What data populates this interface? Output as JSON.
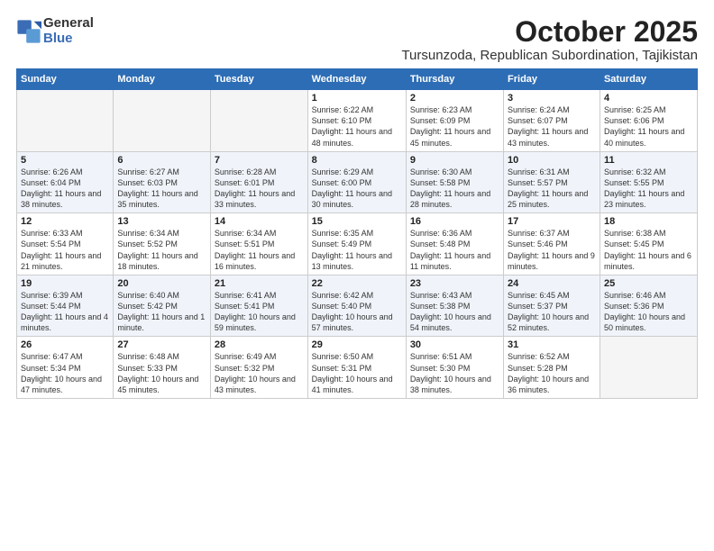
{
  "logo": {
    "general": "General",
    "blue": "Blue"
  },
  "header": {
    "month": "October 2025",
    "location": "Tursunzoda, Republican Subordination, Tajikistan"
  },
  "weekdays": [
    "Sunday",
    "Monday",
    "Tuesday",
    "Wednesday",
    "Thursday",
    "Friday",
    "Saturday"
  ],
  "weeks": [
    [
      {
        "day": null
      },
      {
        "day": null
      },
      {
        "day": null
      },
      {
        "day": "1",
        "sunrise": "6:22 AM",
        "sunset": "6:10 PM",
        "daylight": "11 hours and 48 minutes."
      },
      {
        "day": "2",
        "sunrise": "6:23 AM",
        "sunset": "6:09 PM",
        "daylight": "11 hours and 45 minutes."
      },
      {
        "day": "3",
        "sunrise": "6:24 AM",
        "sunset": "6:07 PM",
        "daylight": "11 hours and 43 minutes."
      },
      {
        "day": "4",
        "sunrise": "6:25 AM",
        "sunset": "6:06 PM",
        "daylight": "11 hours and 40 minutes."
      }
    ],
    [
      {
        "day": "5",
        "sunrise": "6:26 AM",
        "sunset": "6:04 PM",
        "daylight": "11 hours and 38 minutes."
      },
      {
        "day": "6",
        "sunrise": "6:27 AM",
        "sunset": "6:03 PM",
        "daylight": "11 hours and 35 minutes."
      },
      {
        "day": "7",
        "sunrise": "6:28 AM",
        "sunset": "6:01 PM",
        "daylight": "11 hours and 33 minutes."
      },
      {
        "day": "8",
        "sunrise": "6:29 AM",
        "sunset": "6:00 PM",
        "daylight": "11 hours and 30 minutes."
      },
      {
        "day": "9",
        "sunrise": "6:30 AM",
        "sunset": "5:58 PM",
        "daylight": "11 hours and 28 minutes."
      },
      {
        "day": "10",
        "sunrise": "6:31 AM",
        "sunset": "5:57 PM",
        "daylight": "11 hours and 25 minutes."
      },
      {
        "day": "11",
        "sunrise": "6:32 AM",
        "sunset": "5:55 PM",
        "daylight": "11 hours and 23 minutes."
      }
    ],
    [
      {
        "day": "12",
        "sunrise": "6:33 AM",
        "sunset": "5:54 PM",
        "daylight": "11 hours and 21 minutes."
      },
      {
        "day": "13",
        "sunrise": "6:34 AM",
        "sunset": "5:52 PM",
        "daylight": "11 hours and 18 minutes."
      },
      {
        "day": "14",
        "sunrise": "6:34 AM",
        "sunset": "5:51 PM",
        "daylight": "11 hours and 16 minutes."
      },
      {
        "day": "15",
        "sunrise": "6:35 AM",
        "sunset": "5:49 PM",
        "daylight": "11 hours and 13 minutes."
      },
      {
        "day": "16",
        "sunrise": "6:36 AM",
        "sunset": "5:48 PM",
        "daylight": "11 hours and 11 minutes."
      },
      {
        "day": "17",
        "sunrise": "6:37 AM",
        "sunset": "5:46 PM",
        "daylight": "11 hours and 9 minutes."
      },
      {
        "day": "18",
        "sunrise": "6:38 AM",
        "sunset": "5:45 PM",
        "daylight": "11 hours and 6 minutes."
      }
    ],
    [
      {
        "day": "19",
        "sunrise": "6:39 AM",
        "sunset": "5:44 PM",
        "daylight": "11 hours and 4 minutes."
      },
      {
        "day": "20",
        "sunrise": "6:40 AM",
        "sunset": "5:42 PM",
        "daylight": "11 hours and 1 minute."
      },
      {
        "day": "21",
        "sunrise": "6:41 AM",
        "sunset": "5:41 PM",
        "daylight": "10 hours and 59 minutes."
      },
      {
        "day": "22",
        "sunrise": "6:42 AM",
        "sunset": "5:40 PM",
        "daylight": "10 hours and 57 minutes."
      },
      {
        "day": "23",
        "sunrise": "6:43 AM",
        "sunset": "5:38 PM",
        "daylight": "10 hours and 54 minutes."
      },
      {
        "day": "24",
        "sunrise": "6:45 AM",
        "sunset": "5:37 PM",
        "daylight": "10 hours and 52 minutes."
      },
      {
        "day": "25",
        "sunrise": "6:46 AM",
        "sunset": "5:36 PM",
        "daylight": "10 hours and 50 minutes."
      }
    ],
    [
      {
        "day": "26",
        "sunrise": "6:47 AM",
        "sunset": "5:34 PM",
        "daylight": "10 hours and 47 minutes."
      },
      {
        "day": "27",
        "sunrise": "6:48 AM",
        "sunset": "5:33 PM",
        "daylight": "10 hours and 45 minutes."
      },
      {
        "day": "28",
        "sunrise": "6:49 AM",
        "sunset": "5:32 PM",
        "daylight": "10 hours and 43 minutes."
      },
      {
        "day": "29",
        "sunrise": "6:50 AM",
        "sunset": "5:31 PM",
        "daylight": "10 hours and 41 minutes."
      },
      {
        "day": "30",
        "sunrise": "6:51 AM",
        "sunset": "5:30 PM",
        "daylight": "10 hours and 38 minutes."
      },
      {
        "day": "31",
        "sunrise": "6:52 AM",
        "sunset": "5:28 PM",
        "daylight": "10 hours and 36 minutes."
      },
      {
        "day": null
      }
    ]
  ]
}
